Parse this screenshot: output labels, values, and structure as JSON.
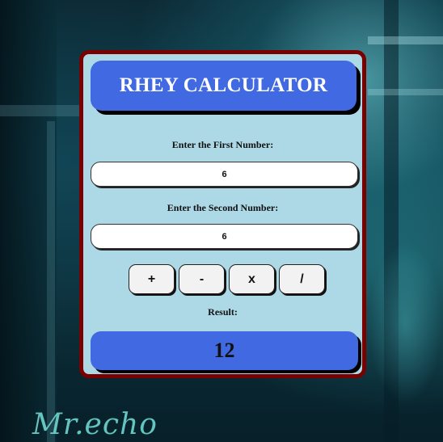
{
  "app": {
    "title": "RHEY CALCULATOR",
    "accent_color": "#4169e1",
    "panel_color": "#add8e6",
    "border_color": "#7a0000"
  },
  "form": {
    "first_label": "Enter the First Number:",
    "first_value": "6",
    "second_label": "Enter the Second Number:",
    "second_value": "6"
  },
  "operations": [
    "+",
    "-",
    "x",
    "/"
  ],
  "result": {
    "label": "Result:",
    "value": "12"
  },
  "background": {
    "signature": "Mr.echo"
  }
}
